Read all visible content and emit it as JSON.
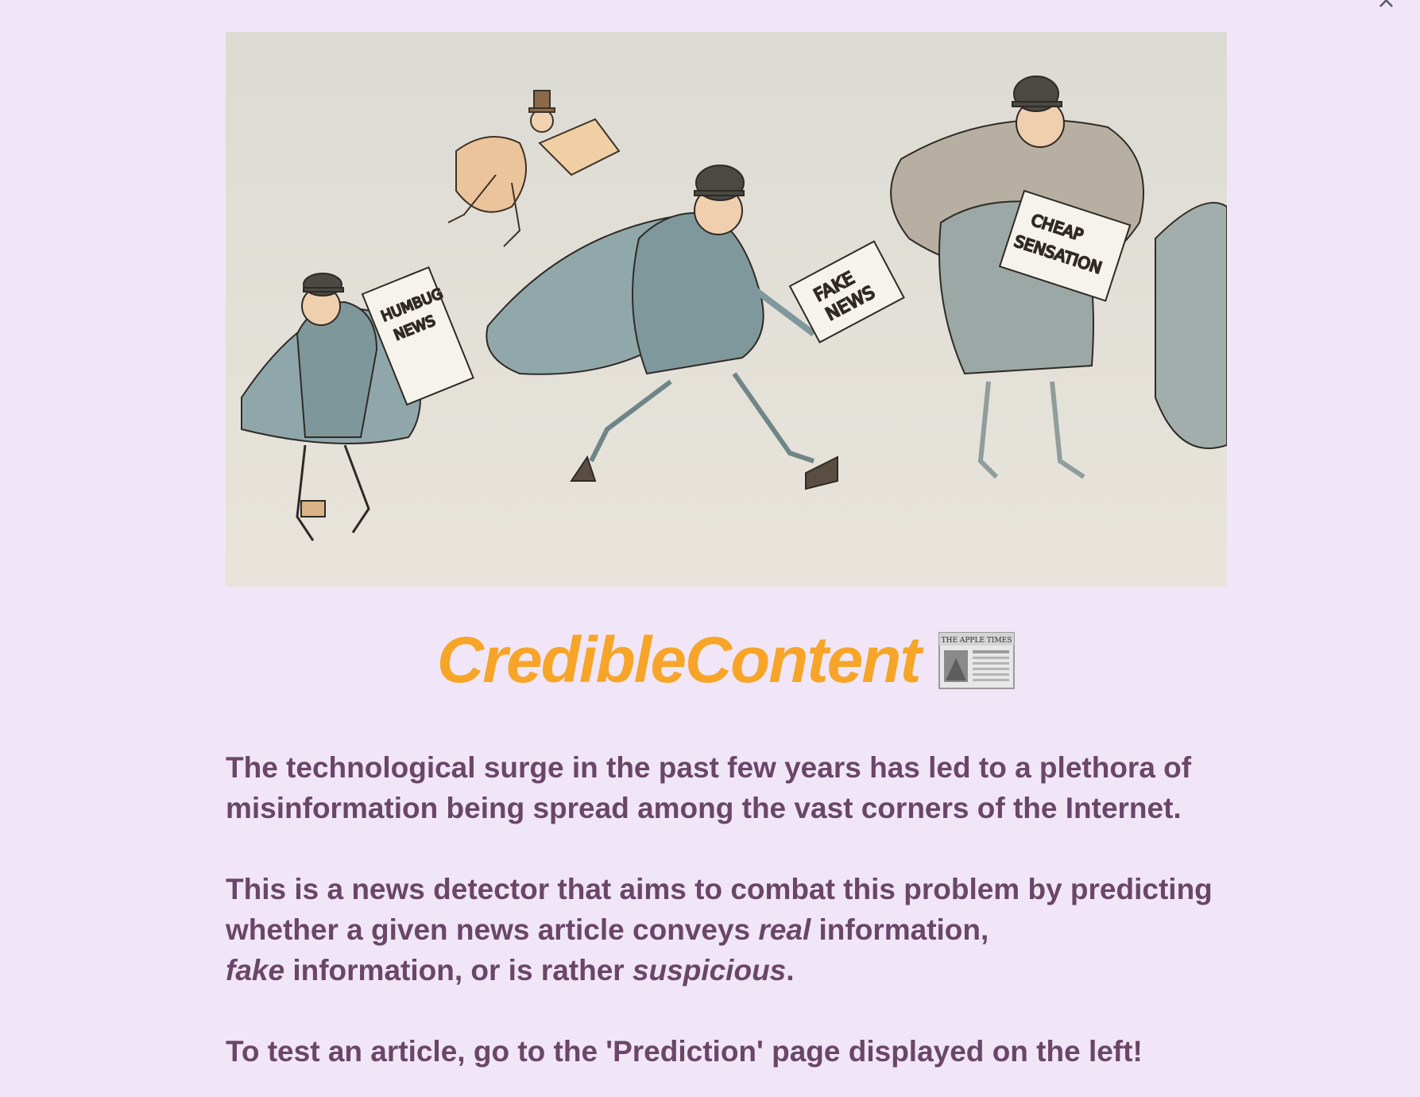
{
  "close_icon": "×",
  "hero": {
    "alt": "Vintage cartoon of newspaper men running with papers labeled HUMBUG NEWS, FAKE NEWS and CHEAP SENSATION",
    "paper_labels": {
      "humbug": [
        "HUMBUG",
        "NEWS"
      ],
      "fake": [
        "FAKE",
        "NEWS"
      ],
      "cheap": [
        "CHEAP",
        "SENSATION"
      ]
    }
  },
  "title": "CredibleContent",
  "title_icon": "newspaper-icon",
  "newspaper": {
    "masthead": "THE APPLE TIMES"
  },
  "paragraphs": {
    "p1": "The technological surge in the past few years has led to a plethora of misinformation being spread among the vast corners of the Internet.",
    "p2_part1": "This is a news detector that aims to combat this problem by predicting whether a given news article conveys ",
    "p2_real": "real",
    "p2_part2": " information, ",
    "p2_fake": "fake",
    "p2_part3": " information, or is rather ",
    "p2_suspicious": "suspicious",
    "p2_end": ".",
    "p3": "To test an article, go to the 'Prediction' page displayed on the left!"
  },
  "colors": {
    "background": "#f1e6f7",
    "title": "#f7a528",
    "text": "#6a4668"
  }
}
